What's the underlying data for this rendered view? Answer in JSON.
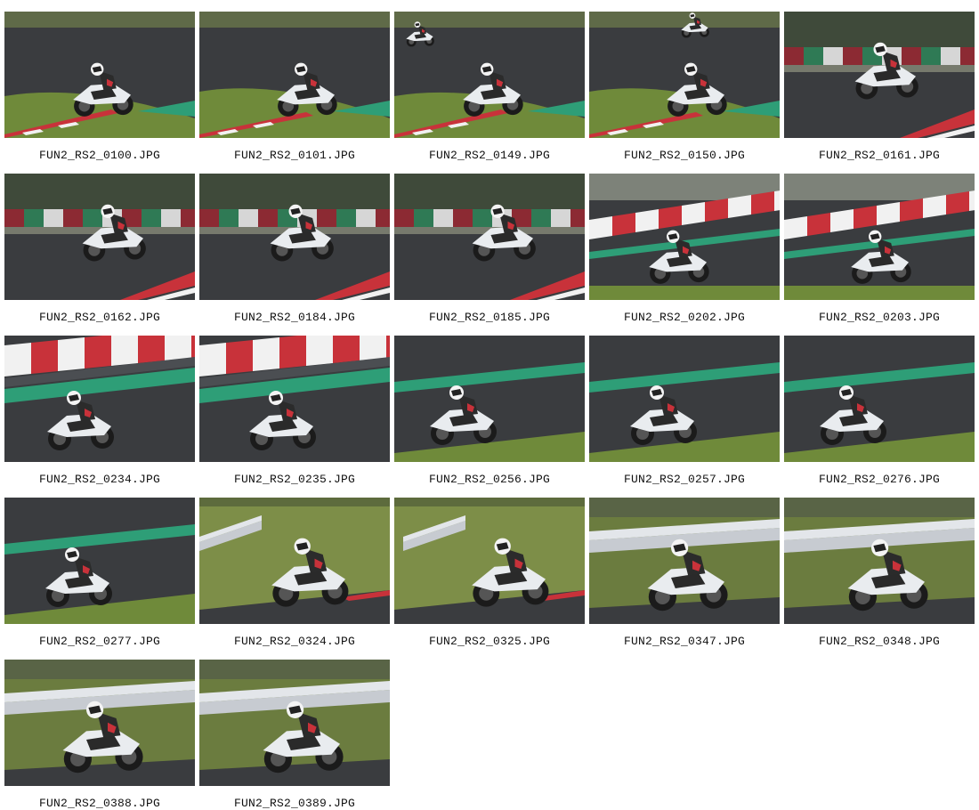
{
  "gallery": {
    "photos": [
      {
        "filename": "FUN2_RS2_0100.JPG",
        "scene": "track-grass-kerb"
      },
      {
        "filename": "FUN2_RS2_0101.JPG",
        "scene": "track-grass-kerb"
      },
      {
        "filename": "FUN2_RS2_0149.JPG",
        "scene": "track-grass-kerb-two-bikes"
      },
      {
        "filename": "FUN2_RS2_0150.JPG",
        "scene": "track-grass-kerb-two-bikes"
      },
      {
        "filename": "FUN2_RS2_0161.JPG",
        "scene": "track-barrier-kerb"
      },
      {
        "filename": "FUN2_RS2_0162.JPG",
        "scene": "track-barrier-kerb"
      },
      {
        "filename": "FUN2_RS2_0184.JPG",
        "scene": "track-barrier-kerb"
      },
      {
        "filename": "FUN2_RS2_0185.JPG",
        "scene": "track-barrier-kerb"
      },
      {
        "filename": "FUN2_RS2_0202.JPG",
        "scene": "track-redwhite-wall"
      },
      {
        "filename": "FUN2_RS2_0203.JPG",
        "scene": "track-redwhite-wall"
      },
      {
        "filename": "FUN2_RS2_0234.JPG",
        "scene": "track-redwhite-green"
      },
      {
        "filename": "FUN2_RS2_0235.JPG",
        "scene": "track-redwhite-green"
      },
      {
        "filename": "FUN2_RS2_0256.JPG",
        "scene": "track-green-stripe"
      },
      {
        "filename": "FUN2_RS2_0257.JPG",
        "scene": "track-green-stripe"
      },
      {
        "filename": "FUN2_RS2_0276.JPG",
        "scene": "track-green-stripe"
      },
      {
        "filename": "FUN2_RS2_0277.JPG",
        "scene": "track-green-stripe"
      },
      {
        "filename": "FUN2_RS2_0324.JPG",
        "scene": "grass-field-guardrail"
      },
      {
        "filename": "FUN2_RS2_0325.JPG",
        "scene": "grass-field-guardrail"
      },
      {
        "filename": "FUN2_RS2_0347.JPG",
        "scene": "guardrail-grass"
      },
      {
        "filename": "FUN2_RS2_0348.JPG",
        "scene": "guardrail-grass"
      },
      {
        "filename": "FUN2_RS2_0388.JPG",
        "scene": "guardrail-grass"
      },
      {
        "filename": "FUN2_RS2_0389.JPG",
        "scene": "guardrail-grass"
      }
    ]
  },
  "colors": {
    "page_background": "#ffffff",
    "caption_text": "#111111",
    "asphalt": "#3a3c3f",
    "grass": "#6f8a3a",
    "kerb_red": "#c8323a",
    "kerb_white": "#f1f1f1",
    "track_green": "#2e9e77",
    "bike_white": "#e9ecef"
  }
}
